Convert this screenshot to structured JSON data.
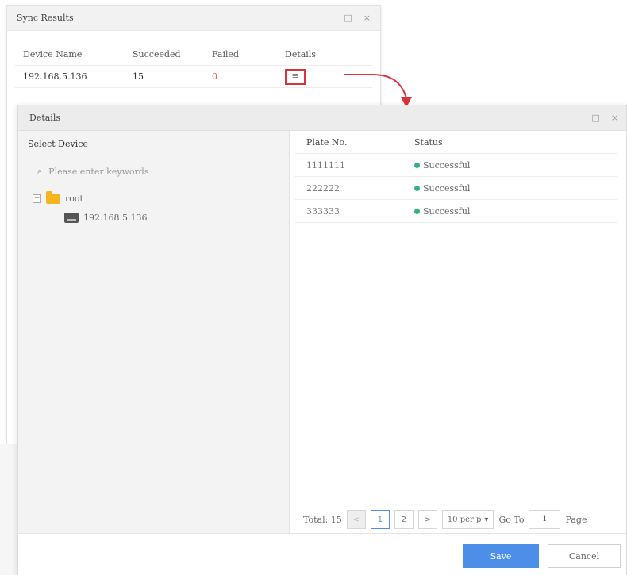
{
  "sync_dialog": {
    "title": "Sync Results",
    "restore_icon": "□",
    "close_icon": "×",
    "columns": [
      "Device Name",
      "Succeeded",
      "Failed",
      "Details"
    ],
    "row": {
      "device": "192.168.5.136",
      "succeeded": "15",
      "failed": "0",
      "details_icon": "≣"
    }
  },
  "details_dialog": {
    "title": "Details",
    "restore_icon": "□",
    "close_icon": "×",
    "left": {
      "title": "Select Device",
      "search_placeholder": "Please enter keywords",
      "search_icon": "⌕",
      "tree": {
        "root_label": "root",
        "root_expand": "−",
        "device_label": "192.168.5.136"
      }
    },
    "table": {
      "headers": [
        "Plate No.",
        "Status"
      ],
      "rows": [
        {
          "plate": "1111111",
          "status": "Successful"
        },
        {
          "plate": "222222",
          "status": "Successful"
        },
        {
          "plate": "333333",
          "status": "Successful"
        }
      ]
    },
    "pagination": {
      "total": "Total: 15",
      "prev": "<",
      "page1": "1",
      "page2": "2",
      "next": ">",
      "per_page": "10 per p",
      "per_page_caret": "▾",
      "goto": "Go To",
      "page_value": "1",
      "page_suffix": "Page"
    },
    "footer": {
      "save": "Save",
      "cancel": "Cancel"
    }
  },
  "colors": {
    "accent": "#4d8fe8",
    "success": "#2fb37a",
    "failed": "#e8554d",
    "highlight": "#d9333f"
  }
}
